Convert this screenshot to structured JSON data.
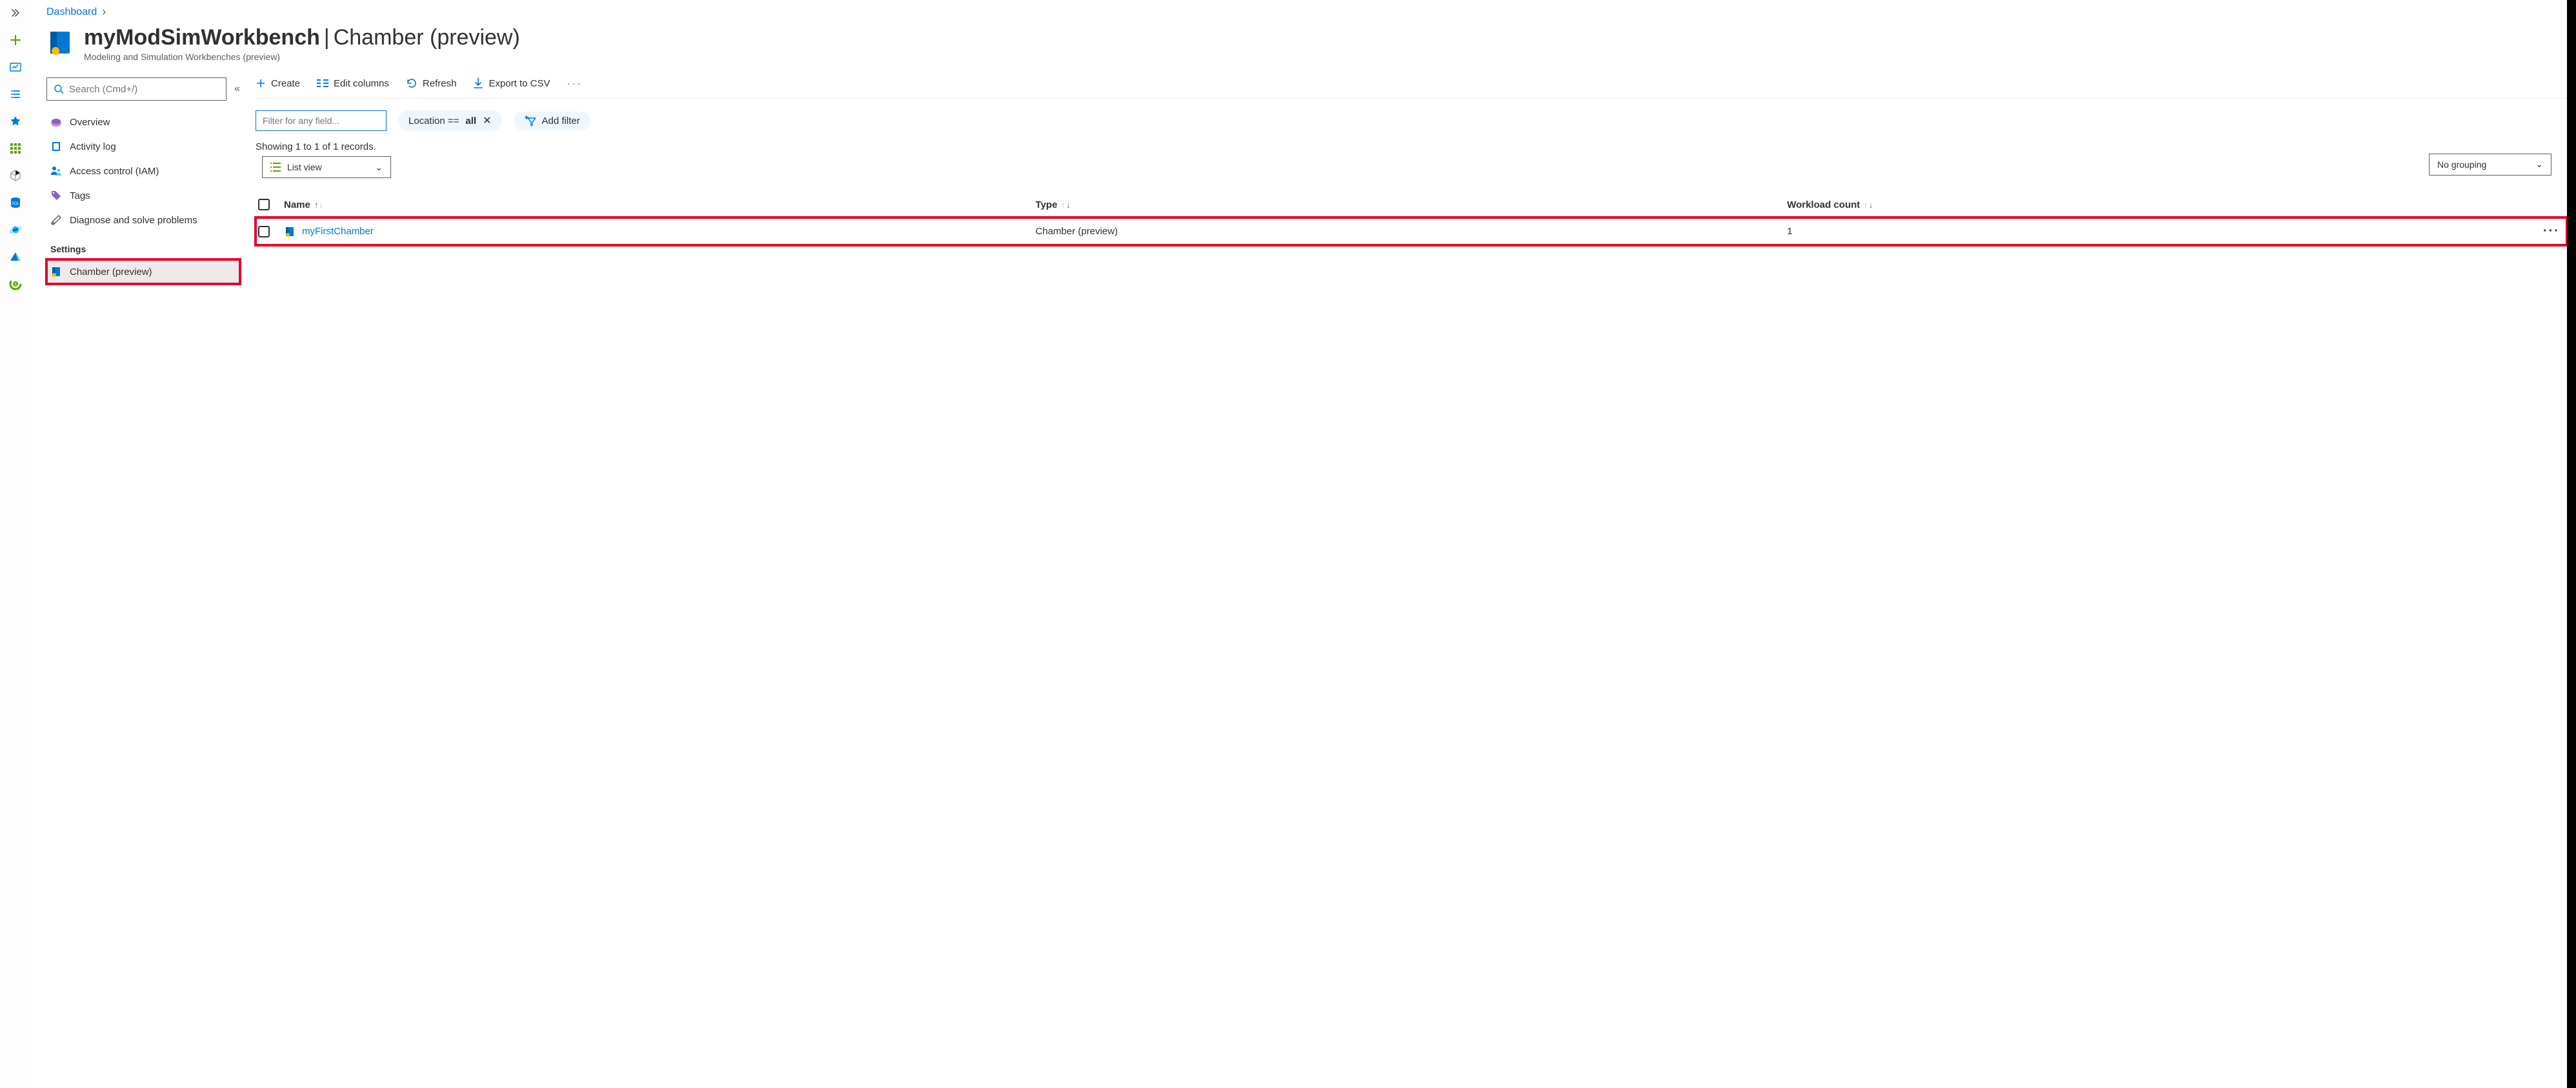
{
  "breadcrumb": {
    "root": "Dashboard"
  },
  "header": {
    "title": "myModSimWorkbench",
    "section": "Chamber (preview)",
    "subtitle": "Modeling and Simulation Workbenches (preview)"
  },
  "sidebar": {
    "search_placeholder": "Search (Cmd+/)",
    "items": [
      {
        "label": "Overview"
      },
      {
        "label": "Activity log"
      },
      {
        "label": "Access control (IAM)"
      },
      {
        "label": "Tags"
      },
      {
        "label": "Diagnose and solve problems"
      }
    ],
    "group_settings": "Settings",
    "settings_items": [
      {
        "label": "Chamber (preview)"
      }
    ]
  },
  "toolbar": {
    "create": "Create",
    "edit_columns": "Edit columns",
    "refresh": "Refresh",
    "export_csv": "Export to CSV"
  },
  "filters": {
    "any_field_placeholder": "Filter for any field...",
    "location_label": "Location ==",
    "location_value": "all",
    "add_filter": "Add filter"
  },
  "status": {
    "records": "Showing 1 to 1 of 1 records.",
    "grouping": "No grouping",
    "list_view": "List view"
  },
  "table": {
    "columns": {
      "name": "Name",
      "type": "Type",
      "workload": "Workload count"
    },
    "rows": [
      {
        "name": "myFirstChamber",
        "type": "Chamber (preview)",
        "workload": "1"
      }
    ]
  }
}
